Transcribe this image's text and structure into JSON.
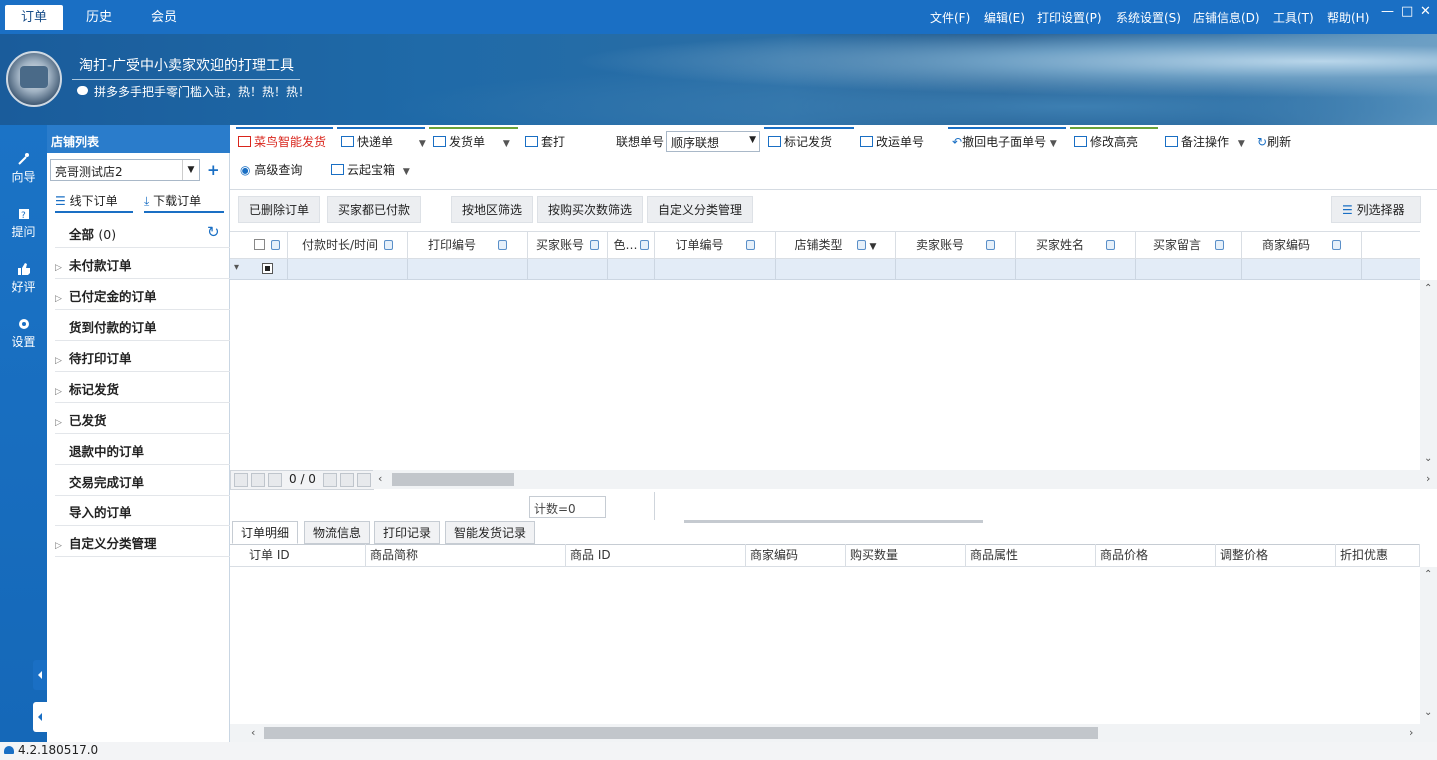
{
  "topbar": {
    "tabs": [
      "订单",
      "历史",
      "会员"
    ],
    "menus": [
      "文件(F)",
      "编辑(E)",
      "打印设置(P)",
      "系统设置(S)",
      "店铺信息(D)",
      "工具(T)",
      "帮助(H)"
    ],
    "window_buttons": [
      "—",
      "□",
      "✕"
    ]
  },
  "banner": {
    "tagline": "淘打-广受中小卖家欢迎的打理工具",
    "subline": "拼多多手把手零门槛入驻，热！热！热！"
  },
  "rail": {
    "items": [
      "向导",
      "提问",
      "好评",
      "设置"
    ]
  },
  "store_panel": {
    "title": "店铺列表",
    "store_select": "亮哥测试店2",
    "add": "+",
    "offline_orders": "线下订单",
    "download_orders": "下载订单",
    "nav": [
      {
        "label": "全部",
        "count": "(0)"
      },
      {
        "label": "未付款订单"
      },
      {
        "label": "已付定金的订单"
      },
      {
        "label": "货到付款的订单"
      },
      {
        "label": "待打印订单"
      },
      {
        "label": "标记发货"
      },
      {
        "label": "已发货"
      },
      {
        "label": "退款中的订单"
      },
      {
        "label": "交易完成订单"
      },
      {
        "label": "导入的订单"
      },
      {
        "label": "自定义分类管理"
      }
    ]
  },
  "toolbar": {
    "cainiao": "菜鸟智能发货",
    "express": "快递单",
    "delivery": "发货单",
    "print_set": "套打",
    "lianxiang_label": "联想单号",
    "lianxiang_value": "顺序联想",
    "mark_ship": "标记发货",
    "change_no": "改运单号",
    "revoke": "撤回电子面单号",
    "highlight": "修改高亮",
    "remark": "备注操作",
    "refresh": "刷新",
    "advanced": "高级查询",
    "cloud": "云起宝箱"
  },
  "filters": [
    "已删除订单",
    "买家都已付款",
    "按地区筛选",
    "按购买次数筛选",
    "自定义分类管理"
  ],
  "column_picker": "列选择器",
  "grid": {
    "columns": [
      "付款时长/时间",
      "打印编号",
      "买家账号",
      "色…",
      "订单编号",
      "店铺类型",
      "卖家账号",
      "买家姓名",
      "买家留言",
      "商家编码"
    ],
    "pager": "0 / 0",
    "count": "计数=0"
  },
  "bottom_tabs": [
    "订单明细",
    "物流信息",
    "打印记录",
    "智能发货记录"
  ],
  "detail_columns": [
    "订单 ID",
    "商品简称",
    "商品 ID",
    "商家编码",
    "购买数量",
    "商品属性",
    "商品价格",
    "调整价格",
    "折扣优惠"
  ],
  "status": {
    "version": "4.2.180517.0"
  },
  "colors": {
    "brand": "#1a6fc4",
    "accent_red": "#d9251c"
  }
}
